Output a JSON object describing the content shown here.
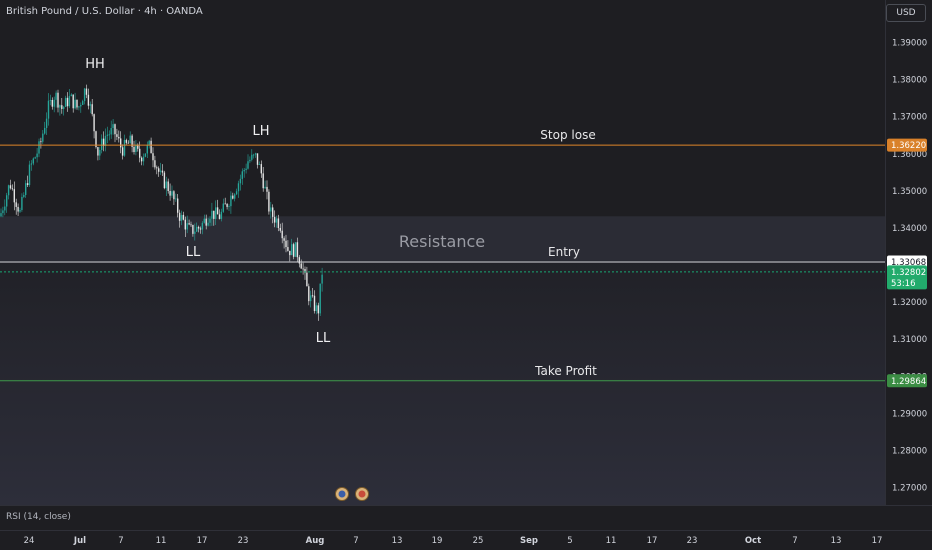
{
  "header": {
    "symbol_title": "British Pound / U.S. Dollar · 4h · OANDA",
    "currency_button": "USD"
  },
  "rsi_label": "RSI (14, close)",
  "colors": {
    "background": "#1e1e22",
    "zone": "#2b2c35",
    "stop_line": "#e0862a",
    "entry_line": "#d6d8de",
    "current_line": "#1aa772",
    "tp_line": "#3f9a4a",
    "up_candle": "#26a69a",
    "down_candle": "#e5e5e5"
  },
  "chart_data": {
    "type": "candlestick",
    "symbol": "GBPUSD",
    "timeframe": "4h",
    "ylim": [
      1.2635,
      1.3975
    ],
    "y_ticks": [
      "1.39000",
      "1.38000",
      "1.37000",
      "1.36000",
      "1.35000",
      "1.34000",
      "1.33000",
      "1.32000",
      "1.31000",
      "1.30000",
      "1.29000",
      "1.28000",
      "1.27000"
    ],
    "x_ticks": [
      "24",
      "Jul",
      "7",
      "11",
      "17",
      "23",
      "Aug",
      "7",
      "13",
      "19",
      "25",
      "Sep",
      "5",
      "11",
      "17",
      "23",
      "Oct",
      "7",
      "13",
      "17"
    ],
    "x_tick_bold": [
      "Jul",
      "Aug",
      "Sep",
      "Oct"
    ],
    "price_path": [
      [
        0,
        1.343
      ],
      [
        10,
        1.352
      ],
      [
        20,
        1.344
      ],
      [
        30,
        1.356
      ],
      [
        40,
        1.362
      ],
      [
        48,
        1.372
      ],
      [
        55,
        1.376
      ],
      [
        62,
        1.372
      ],
      [
        70,
        1.375
      ],
      [
        78,
        1.372
      ],
      [
        86,
        1.378
      ],
      [
        92,
        1.37
      ],
      [
        98,
        1.36
      ],
      [
        106,
        1.365
      ],
      [
        114,
        1.366
      ],
      [
        122,
        1.361
      ],
      [
        130,
        1.363
      ],
      [
        140,
        1.359
      ],
      [
        150,
        1.362
      ],
      [
        160,
        1.354
      ],
      [
        170,
        1.35
      ],
      [
        180,
        1.343
      ],
      [
        190,
        1.339
      ],
      [
        200,
        1.34
      ],
      [
        210,
        1.344
      ],
      [
        220,
        1.343
      ],
      [
        230,
        1.348
      ],
      [
        240,
        1.353
      ],
      [
        248,
        1.358
      ],
      [
        256,
        1.359
      ],
      [
        262,
        1.354
      ],
      [
        270,
        1.344
      ],
      [
        280,
        1.341
      ],
      [
        288,
        1.334
      ],
      [
        296,
        1.334
      ],
      [
        302,
        1.33
      ],
      [
        308,
        1.322
      ],
      [
        314,
        1.319
      ],
      [
        318,
        1.317
      ],
      [
        322,
        1.328
      ],
      [
        324,
        1.328
      ]
    ],
    "levels": [
      {
        "name": "stop",
        "price": 1.3622,
        "tag": "1.36220",
        "label": "Stop lose"
      },
      {
        "name": "entry",
        "price": 1.33068,
        "tag": "1.33068",
        "label": "Entry"
      },
      {
        "name": "current",
        "price": 1.32802,
        "tag": "1.32802",
        "countdown": "53:16"
      },
      {
        "name": "take-profit",
        "price": 1.29864,
        "tag": "1.29864",
        "label": "Take Profit"
      }
    ],
    "zone": {
      "top": 1.343,
      "bottom": 1.331,
      "label": "Resistance"
    },
    "annotations": [
      "HH",
      "LH",
      "LL",
      "LL"
    ]
  }
}
